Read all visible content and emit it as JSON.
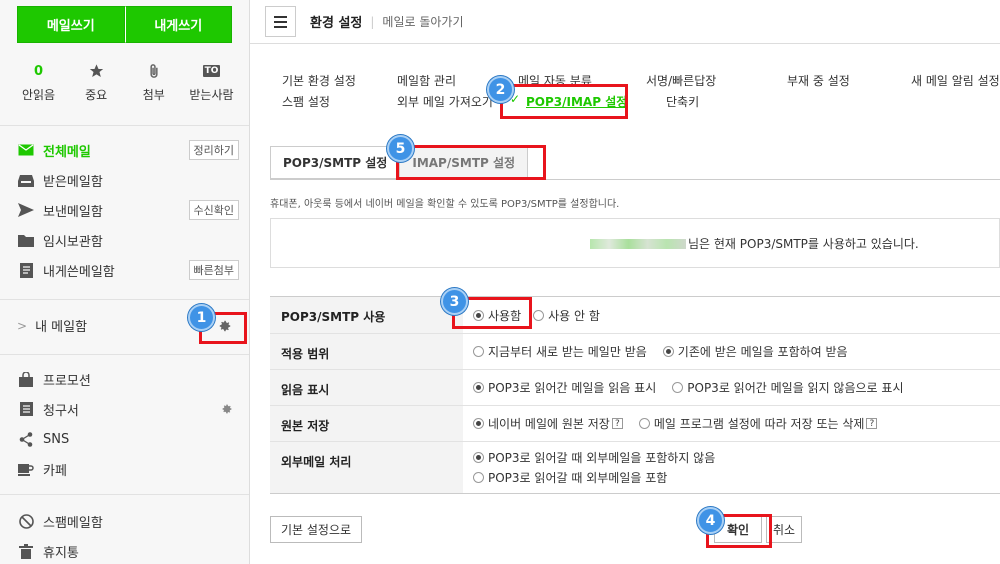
{
  "sidebar": {
    "compose_label": "메일쓰기",
    "self_compose_label": "내게쓰기",
    "quick": [
      {
        "top": "0",
        "label": "안읽음"
      },
      {
        "icon": "star-icon",
        "label": "중요"
      },
      {
        "icon": "paperclip-icon",
        "label": "첨부"
      },
      {
        "top": "TO",
        "label": "받는사람"
      }
    ],
    "mailboxes": [
      {
        "label": "전체메일",
        "tag": "정리하기",
        "icon": "envelope-icon"
      },
      {
        "label": "받은메일함",
        "tag": "",
        "icon": "inbox-icon"
      },
      {
        "label": "보낸메일함",
        "tag": "수신확인",
        "icon": "send-icon"
      },
      {
        "label": "임시보관함",
        "tag": "",
        "icon": "folder-icon"
      },
      {
        "label": "내게쓴메일함",
        "tag": "빠른첨부",
        "icon": "note-icon"
      }
    ],
    "my_mailbox": "내 메일함",
    "extras": [
      {
        "label": "프로모션",
        "icon": "bag-icon"
      },
      {
        "label": "청구서",
        "icon": "list-icon"
      },
      {
        "label": "SNS",
        "icon": "share-icon"
      },
      {
        "label": "카페",
        "icon": "cup-icon"
      }
    ],
    "bottom": [
      {
        "label": "스팸메일함",
        "icon": "block-icon"
      },
      {
        "label": "휴지통",
        "icon": "trash-icon"
      }
    ]
  },
  "topbar": {
    "title": "환경 설정",
    "back": "메일로 돌아가기"
  },
  "settings_nav": {
    "row1": [
      "기본 환경 설정",
      "메일함 관리",
      "메일 자동 분류",
      "서명/빠른답장",
      "부재 중 설정",
      "새 메일 알림 설정"
    ],
    "row2": [
      "스팸 설정",
      "외부 메일 가져오기",
      "POP3/IMAP 설정",
      "단축키"
    ],
    "active": "POP3/IMAP 설정"
  },
  "tabs": [
    "POP3/SMTP 설정",
    "IMAP/SMTP 설정"
  ],
  "description": "휴대폰, 아웃룩 등에서 네이버 메일을 확인할 수 있도록 POP3/SMTP를 설정합니다.",
  "status_text": "님은 현재 POP3/SMTP를 사용하고 있습니다.",
  "rows": [
    {
      "label": "POP3/SMTP 사용",
      "options": [
        "사용함",
        "사용 안 함"
      ],
      "selected": 0
    },
    {
      "label": "적용 범위",
      "options": [
        "지금부터 새로 받는 메일만 받음",
        "기존에 받은 메일을 포함하여 받음"
      ],
      "selected": 1
    },
    {
      "label": "읽음 표시",
      "options": [
        "POP3로 읽어간 메일을 읽음 표시",
        "POP3로 읽어간 메일을 읽지 않음으로 표시"
      ],
      "selected": 0
    },
    {
      "label": "원본 저장",
      "options": [
        "네이버 메일에 원본 저장",
        "메일 프로그램 설정에 따라 저장 또는 삭제"
      ],
      "selected": 0,
      "help": "?"
    },
    {
      "label": "외부메일 처리",
      "options": [
        "POP3로 읽어갈 때 외부메일을 포함하지 않음",
        "POP3로 읽어갈 때 외부메일을 포함"
      ],
      "selected": 0
    }
  ],
  "buttons": {
    "default": "기본 설정으로",
    "confirm": "확인",
    "cancel": "취소"
  },
  "markers": [
    "1",
    "2",
    "3",
    "4",
    "5"
  ],
  "colors": {
    "accent": "#1ec800",
    "marker": "#3f93e6",
    "highlight": "#e8141c"
  }
}
